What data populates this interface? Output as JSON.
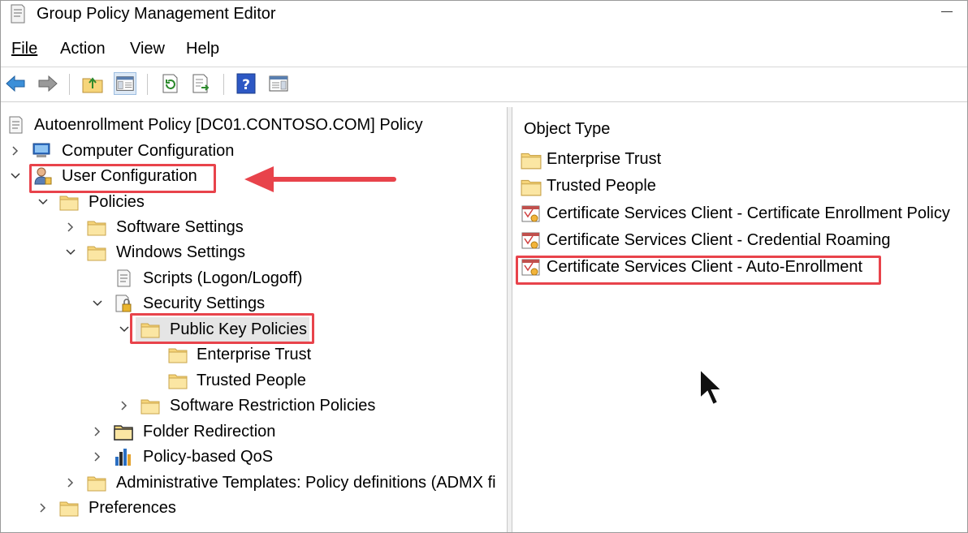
{
  "window": {
    "title": "Group Policy Management Editor"
  },
  "menu": {
    "file": "File",
    "action": "Action",
    "view": "View",
    "help": "Help"
  },
  "toolbar": {
    "buttons": [
      "back-icon",
      "forward-icon",
      "up-folder-icon",
      "show-hide-tree-icon",
      "refresh-icon",
      "export-list-icon",
      "help-icon",
      "show-action-pane-icon"
    ]
  },
  "tree": {
    "root": "Autoenrollment Policy [DC01.CONTOSO.COM] Policy",
    "computer_config": "Computer Configuration",
    "user_config": "User Configuration",
    "policies": "Policies",
    "software_settings": "Software Settings",
    "windows_settings": "Windows Settings",
    "scripts": "Scripts (Logon/Logoff)",
    "security_settings": "Security Settings",
    "public_key_policies": "Public Key Policies",
    "enterprise_trust": "Enterprise Trust",
    "trusted_people": "Trusted People",
    "software_restriction": "Software Restriction Policies",
    "folder_redirection": "Folder Redirection",
    "policy_qos": "Policy-based QoS",
    "admin_templates": "Administrative Templates: Policy definitions (ADMX fi",
    "preferences": "Preferences"
  },
  "list": {
    "column_header": "Object Type",
    "items": [
      "Enterprise Trust",
      "Trusted People",
      "Certificate Services Client - Certificate Enrollment Policy",
      "Certificate Services Client - Credential Roaming",
      "Certificate Services Client - Auto-Enrollment"
    ]
  },
  "colors": {
    "highlight": "#e8434b",
    "selection": "#e5e5e5",
    "folder": "#f6d57a"
  }
}
